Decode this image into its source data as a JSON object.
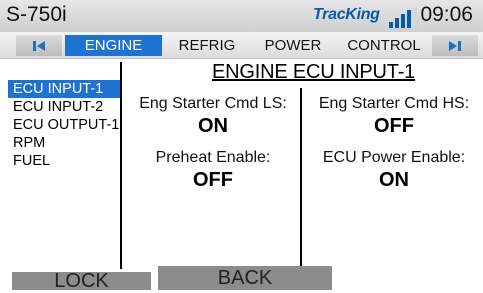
{
  "status": {
    "device": "S-750i",
    "logo_text": "TracKing",
    "time": "09:06"
  },
  "tabs": {
    "prev_icon": "skip-previous-icon",
    "next_icon": "skip-next-icon",
    "items": [
      {
        "label": "ENGINE",
        "active": true
      },
      {
        "label": "REFRIG",
        "active": false
      },
      {
        "label": "POWER",
        "active": false
      },
      {
        "label": "CONTROL",
        "active": false
      }
    ]
  },
  "menu": {
    "items": [
      {
        "label": "ECU INPUT-1",
        "selected": true
      },
      {
        "label": "ECU INPUT-2",
        "selected": false
      },
      {
        "label": "ECU OUTPUT-1",
        "selected": false
      },
      {
        "label": "RPM",
        "selected": false
      },
      {
        "label": "FUEL",
        "selected": false
      }
    ]
  },
  "panel": {
    "title": "ENGINE ECU INPUT-1",
    "fields": [
      {
        "label": "Eng Starter Cmd LS:",
        "value": "ON"
      },
      {
        "label": "Eng Starter Cmd HS:",
        "value": "OFF"
      },
      {
        "label": "Preheat Enable:",
        "value": "OFF"
      },
      {
        "label": "ECU Power Enable:",
        "value": "ON"
      }
    ]
  },
  "buttons": {
    "lock": "LOCK",
    "back": "BACK"
  },
  "colors": {
    "accent": "#1e73d0",
    "button_gray": "#8c8c8c",
    "logo_blue": "#0a5aa8"
  }
}
